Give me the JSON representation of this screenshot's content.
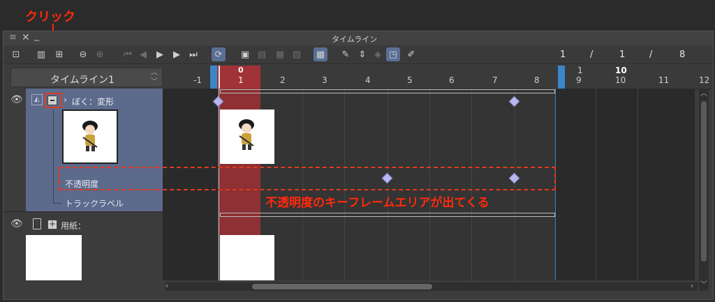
{
  "annotations": {
    "click_label": "クリック",
    "opacity_note": "不透明度のキーフレームエリアが出てくる"
  },
  "window": {
    "title": "タイムライン",
    "frame_info": {
      "current": "1",
      "sep1": "/",
      "start": "1",
      "sep2": "/",
      "end": "8"
    }
  },
  "timeline_selector": {
    "label": "タイムライン1"
  },
  "ruler": {
    "markers": [
      "-1",
      "1",
      "2",
      "3",
      "4",
      "5",
      "6",
      "7",
      "8",
      "9",
      "10",
      "11",
      "12"
    ],
    "current_frame_label": "0",
    "end_top_label": "1",
    "end_top_bold": "10"
  },
  "tracks": [
    {
      "name": "ぼく：変形",
      "expanded": true,
      "sublabels": [
        "不透明度",
        "トラックラベル"
      ]
    },
    {
      "name": "用紙：",
      "expanded": false
    }
  ],
  "colors": {
    "accent": "#5c6a8c",
    "annotation": "#ff2a0c",
    "playhead": "#c0393d",
    "keyframe": "#b9b7ef"
  }
}
